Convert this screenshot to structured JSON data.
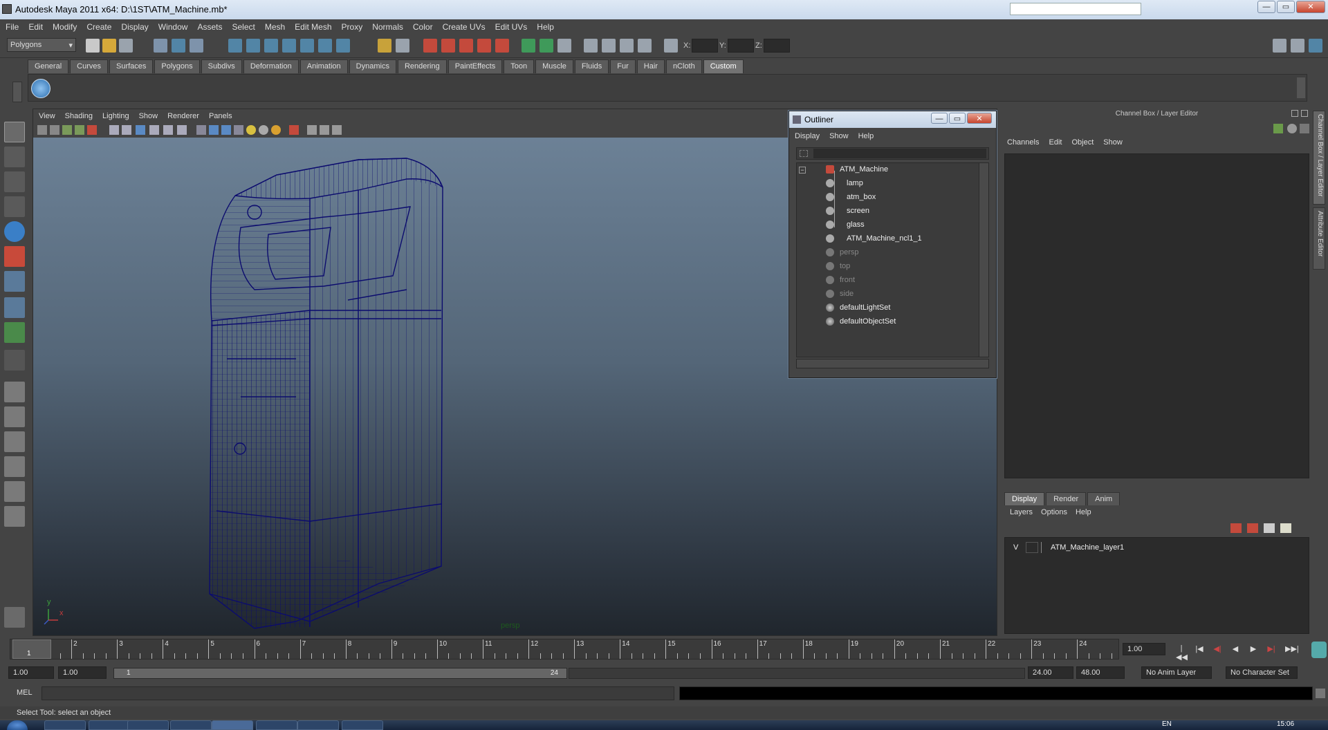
{
  "window": {
    "title": "Autodesk Maya 2011 x64: D:\\1ST\\ATM_Machine.mb*",
    "min": "—",
    "max": "▭",
    "close": "✕"
  },
  "menubar": [
    "File",
    "Edit",
    "Modify",
    "Create",
    "Display",
    "Window",
    "Assets",
    "Select",
    "Mesh",
    "Edit Mesh",
    "Proxy",
    "Normals",
    "Color",
    "Create UVs",
    "Edit UVs",
    "Help"
  ],
  "statusline": {
    "menuset": "Polygons",
    "coords": {
      "x_label": "X:",
      "y_label": "Y:",
      "z_label": "Z:"
    }
  },
  "shelf": {
    "tabs": [
      "General",
      "Curves",
      "Surfaces",
      "Polygons",
      "Subdivs",
      "Deformation",
      "Animation",
      "Dynamics",
      "Rendering",
      "PaintEffects",
      "Toon",
      "Muscle",
      "Fluids",
      "Fur",
      "Hair",
      "nCloth",
      "Custom"
    ],
    "active_tab": "Custom"
  },
  "viewport": {
    "menu": [
      "View",
      "Shading",
      "Lighting",
      "Show",
      "Renderer",
      "Panels"
    ],
    "camera_label": "persp",
    "axis_y": "y",
    "axis_x": "x"
  },
  "outliner": {
    "title": "Outliner",
    "menu": [
      "Display",
      "Show",
      "Help"
    ],
    "expand_glyph": "−",
    "items": [
      {
        "label": "ATM_Machine",
        "level": 0,
        "type": "group",
        "dim": false
      },
      {
        "label": "lamp",
        "level": 1,
        "type": "mesh",
        "dim": false
      },
      {
        "label": "atm_box",
        "level": 1,
        "type": "mesh",
        "dim": false
      },
      {
        "label": "screen",
        "level": 1,
        "type": "mesh",
        "dim": false
      },
      {
        "label": "glass",
        "level": 1,
        "type": "mesh",
        "dim": false
      },
      {
        "label": "ATM_Machine_ncl1_1",
        "level": 1,
        "type": "mesh",
        "dim": false
      },
      {
        "label": "persp",
        "level": 0,
        "type": "camera",
        "dim": true
      },
      {
        "label": "top",
        "level": 0,
        "type": "camera",
        "dim": true
      },
      {
        "label": "front",
        "level": 0,
        "type": "camera",
        "dim": true
      },
      {
        "label": "side",
        "level": 0,
        "type": "camera",
        "dim": true
      },
      {
        "label": "defaultLightSet",
        "level": 0,
        "type": "set",
        "dim": false
      },
      {
        "label": "defaultObjectSet",
        "level": 0,
        "type": "set",
        "dim": false
      }
    ]
  },
  "channelbox": {
    "title": "Channel Box / Layer Editor",
    "menu": [
      "Channels",
      "Edit",
      "Object",
      "Show"
    ],
    "layer_tabs": [
      "Display",
      "Render",
      "Anim"
    ],
    "active_layer_tab": "Display",
    "layer_menu": [
      "Layers",
      "Options",
      "Help"
    ],
    "layers": [
      {
        "visible": "V",
        "name": "ATM_Machine_layer1"
      }
    ]
  },
  "side_tabs": [
    "Channel Box / Layer Editor",
    "Attribute Editor"
  ],
  "timeline": {
    "frames": [
      "1",
      "2",
      "3",
      "4",
      "5",
      "6",
      "7",
      "8",
      "9",
      "10",
      "11",
      "12",
      "13",
      "14",
      "15",
      "16",
      "17",
      "18",
      "19",
      "20",
      "21",
      "22",
      "23",
      "24"
    ],
    "current_frame_label": "1",
    "current_time": "1.00",
    "playback_glyphs": [
      "|◀◀",
      "|◀",
      "◀|",
      "◀",
      "▶",
      "▶|",
      "▶▶|"
    ]
  },
  "range": {
    "start": "1.00",
    "playback_start": "1.00",
    "slider_start": "1",
    "slider_end": "24",
    "playback_end": "24.00",
    "end": "48.00",
    "anim_layer": "No Anim Layer",
    "character_set": "No Character Set"
  },
  "command": {
    "label": "MEL"
  },
  "help_line": "Select Tool: select an object",
  "taskbar": {
    "lang": "EN",
    "clock": "15:06"
  },
  "colors": {
    "wireframe": "#0b0b6e",
    "accent": "#5285a6"
  }
}
